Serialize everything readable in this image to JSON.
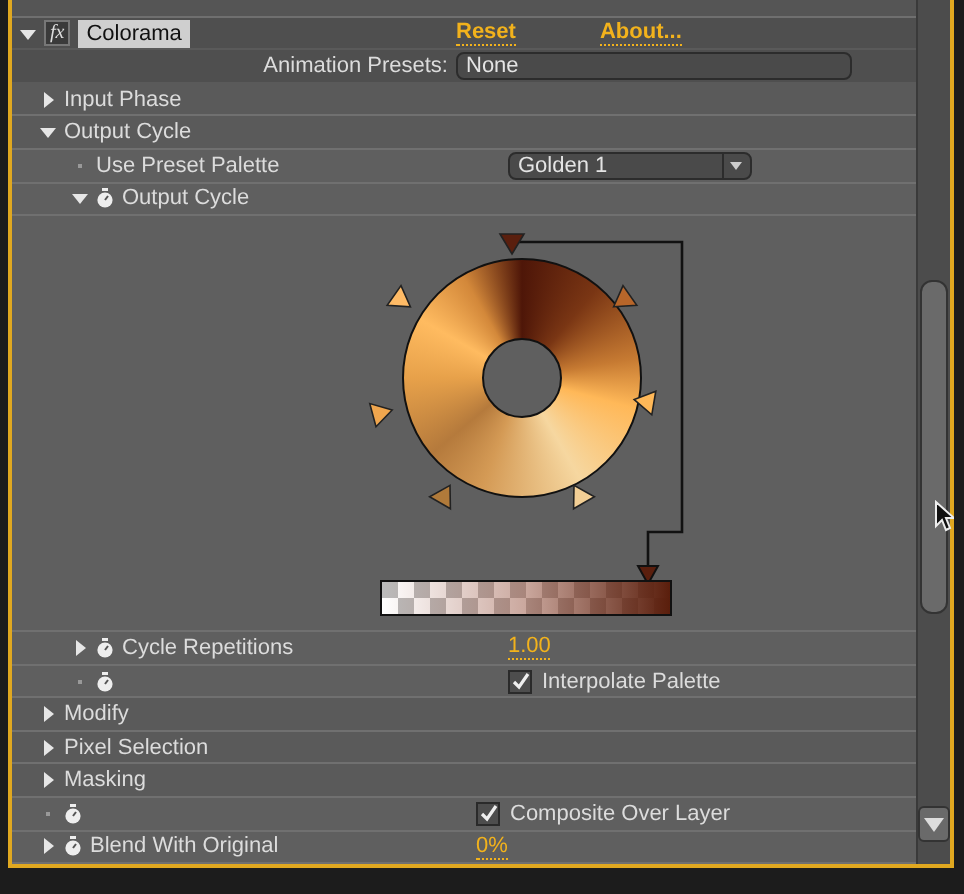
{
  "effect": {
    "badge": "fx",
    "name": "Colorama",
    "reset": "Reset",
    "about": "About...",
    "expanded": true
  },
  "animation_presets": {
    "label": "Animation Presets:",
    "value": "None"
  },
  "rows": [
    {
      "kind": "group",
      "label": "Input Phase",
      "expanded": false,
      "children": []
    },
    {
      "kind": "group",
      "label": "Output Cycle",
      "expanded": true,
      "children": [
        {
          "kind": "dropdown",
          "label": "Use Preset Palette",
          "value": "Golden 1",
          "stopwatch": false
        },
        {
          "kind": "graph",
          "label": "Output Cycle",
          "expanded": true,
          "stopwatch": true
        },
        {
          "kind": "number",
          "label": "Cycle Repetitions",
          "value": "1.00",
          "expanded": false,
          "stopwatch": true
        },
        {
          "kind": "checkbox",
          "label": "Interpolate Palette",
          "checked": true,
          "stopwatch": true
        }
      ]
    },
    {
      "kind": "group",
      "label": "Modify",
      "expanded": false,
      "children": []
    },
    {
      "kind": "group",
      "label": "Pixel Selection",
      "expanded": false,
      "children": []
    },
    {
      "kind": "group",
      "label": "Masking",
      "expanded": false,
      "children": []
    },
    {
      "kind": "checkbox",
      "label": "Composite Over Layer",
      "checked": true,
      "stopwatch": true
    },
    {
      "kind": "number",
      "label": "Blend With Original",
      "value": "0%",
      "expanded": false,
      "stopwatch": true
    }
  ]
}
